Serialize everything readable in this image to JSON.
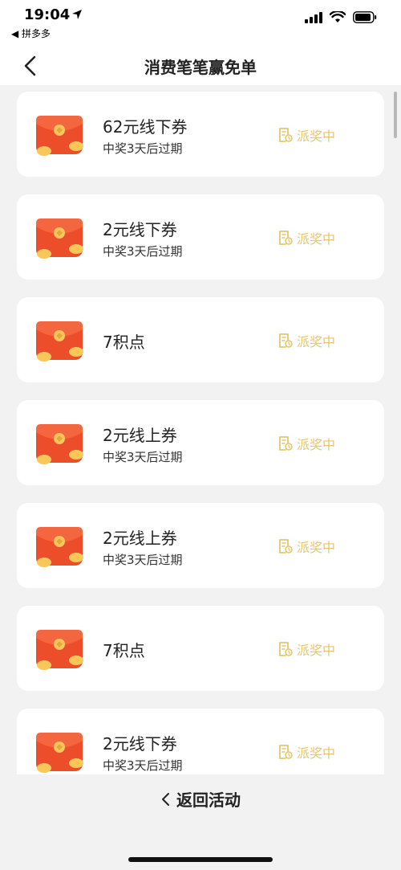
{
  "status_bar": {
    "time": "19:04",
    "back_app": "◀ 拼多多"
  },
  "nav": {
    "title": "消费笔笔赢免单"
  },
  "items": [
    {
      "title": "62元线下券",
      "subtitle": "中奖3天后过期",
      "status": "派奖中"
    },
    {
      "title": "2元线下券",
      "subtitle": "中奖3天后过期",
      "status": "派奖中"
    },
    {
      "title": "7积点",
      "subtitle": "",
      "status": "派奖中"
    },
    {
      "title": "2元线上券",
      "subtitle": "中奖3天后过期",
      "status": "派奖中"
    },
    {
      "title": "2元线上券",
      "subtitle": "中奖3天后过期",
      "status": "派奖中"
    },
    {
      "title": "7积点",
      "subtitle": "",
      "status": "派奖中"
    },
    {
      "title": "2元线下券",
      "subtitle": "中奖3天后过期",
      "status": "派奖中"
    }
  ],
  "bottom": {
    "return_label": "返回活动"
  },
  "colors": {
    "status": "#e6c66b",
    "envelope": "#ec4d2a",
    "coin": "#f7c75a"
  },
  "icons": {
    "item_icon": "red-envelope-icon",
    "status_icon": "document-clock-icon"
  }
}
